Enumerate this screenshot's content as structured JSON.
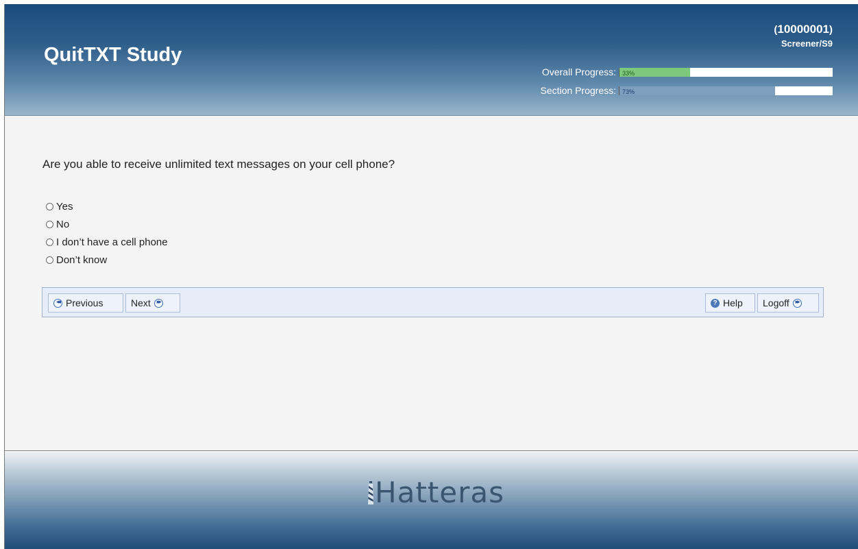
{
  "header": {
    "title": "QuitTXT Study",
    "participant_id": "10000001",
    "screen_id": "Screener/S9",
    "overall_progress_label": "Overall Progress:",
    "overall_progress_text": "33%",
    "overall_progress_fraction": 0.33,
    "section_progress_label": "Section Progress:",
    "section_progress_text": "73%",
    "section_progress_fraction": 0.73
  },
  "question": {
    "text": "Are you able to receive unlimited text messages on your cell phone?",
    "options": [
      {
        "label": "Yes",
        "selected": false
      },
      {
        "label": "No",
        "selected": false
      },
      {
        "label": "I don’t have a cell phone",
        "selected": false
      },
      {
        "label": "Don’t know",
        "selected": false
      }
    ]
  },
  "navigation": {
    "previous_label": "Previous",
    "next_label": "Next",
    "help_label": "Help",
    "logoff_label": "Logoff"
  },
  "footer": {
    "brand_text": "Hatteras",
    "brand_icon": "lighthouse-icon"
  },
  "colors": {
    "header_top": "#1a4c7d",
    "overall_fill": "#7ec87e",
    "section_fill": "#7f9fbf",
    "navbar_bg": "#e6edf8"
  }
}
